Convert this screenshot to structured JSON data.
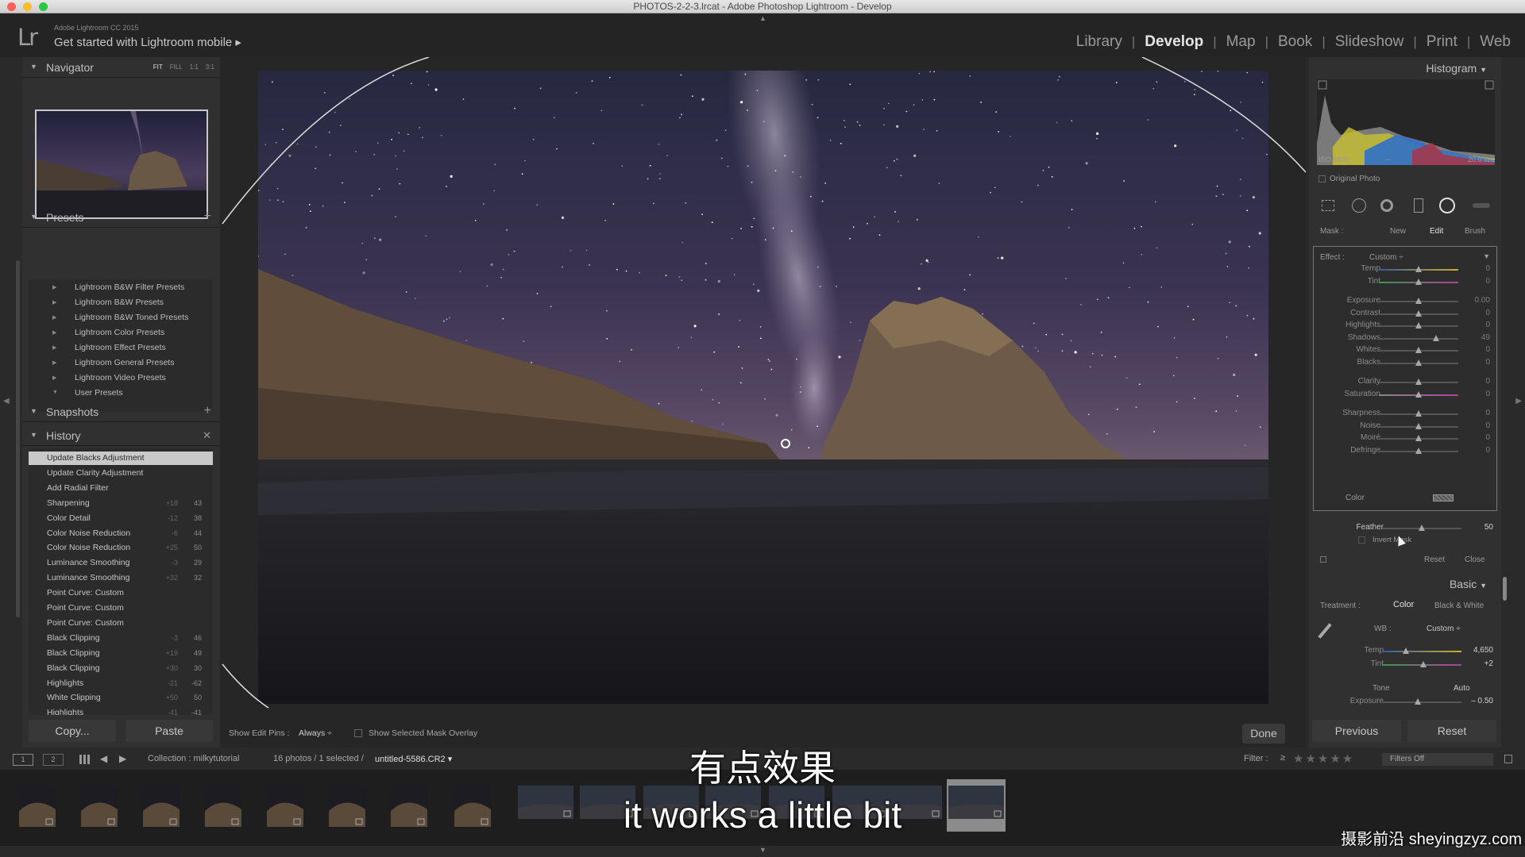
{
  "window": {
    "title": "PHOTOS-2-2-3.lrcat - Adobe Photoshop Lightroom - Develop"
  },
  "identity": {
    "logo": "Lr",
    "brand": "Adobe Lightroom CC 2015",
    "mobile_prompt": "Get started with Lightroom mobile ▸"
  },
  "modules": [
    "Library",
    "Develop",
    "Map",
    "Book",
    "Slideshow",
    "Print",
    "Web"
  ],
  "active_module": "Develop",
  "navigator": {
    "title": "Navigator",
    "zoom": [
      "FIT",
      "FILL",
      "1:1",
      "3:1"
    ]
  },
  "presets": {
    "title": "Presets",
    "items": [
      "Lightroom B&W Filter Presets",
      "Lightroom B&W Presets",
      "Lightroom B&W Toned Presets",
      "Lightroom Color Presets",
      "Lightroom Effect Presets",
      "Lightroom General Presets",
      "Lightroom Video Presets",
      "User Presets"
    ]
  },
  "snapshots": {
    "title": "Snapshots"
  },
  "history": {
    "title": "History",
    "items": [
      {
        "label": "Update Blacks Adjustment",
        "before": "",
        "after": ""
      },
      {
        "label": "Update Clarity Adjustment",
        "before": "",
        "after": ""
      },
      {
        "label": "Add Radial Filter",
        "before": "",
        "after": ""
      },
      {
        "label": "Sharpening",
        "before": "+18",
        "after": "43"
      },
      {
        "label": "Color Detail",
        "before": "-12",
        "after": "38"
      },
      {
        "label": "Color Noise Reduction",
        "before": "-6",
        "after": "44"
      },
      {
        "label": "Color Noise Reduction",
        "before": "+25",
        "after": "50"
      },
      {
        "label": "Luminance Smoothing",
        "before": "-3",
        "after": "29"
      },
      {
        "label": "Luminance Smoothing",
        "before": "+32",
        "after": "32"
      },
      {
        "label": "Point Curve: Custom",
        "before": "",
        "after": ""
      },
      {
        "label": "Point Curve: Custom",
        "before": "",
        "after": ""
      },
      {
        "label": "Point Curve: Custom",
        "before": "",
        "after": ""
      },
      {
        "label": "Black Clipping",
        "before": "-3",
        "after": "46"
      },
      {
        "label": "Black Clipping",
        "before": "+19",
        "after": "49"
      },
      {
        "label": "Black Clipping",
        "before": "+30",
        "after": "30"
      },
      {
        "label": "Highlights",
        "before": "-21",
        "after": "-62"
      },
      {
        "label": "White Clipping",
        "before": "+50",
        "after": "50"
      },
      {
        "label": "Highlights",
        "before": "-41",
        "after": "-41"
      }
    ]
  },
  "left_buttons": {
    "copy": "Copy...",
    "paste": "Paste"
  },
  "toolbar": {
    "show_pins_label": "Show Edit Pins :",
    "show_pins_value": "Always ÷",
    "overlay_label": "Show Selected Mask Overlay",
    "done": "Done"
  },
  "histogram": {
    "title": "Histogram",
    "iso": "ISO 6400",
    "dash": "--",
    "shutter": "20.0 sec",
    "original_photo": "Original Photo"
  },
  "mask": {
    "label": "Mask :",
    "new": "New",
    "edit": "Edit",
    "brush": "Brush"
  },
  "effect": {
    "label": "Effect :",
    "preset": "Custom ÷"
  },
  "sliders": [
    {
      "label": "Temp",
      "value": "0",
      "pos": 0.5
    },
    {
      "label": "Tint",
      "value": "0",
      "pos": 0.5
    },
    {
      "label": "Exposure",
      "value": "0.00",
      "pos": 0.5
    },
    {
      "label": "Contrast",
      "value": "0",
      "pos": 0.5
    },
    {
      "label": "Highlights",
      "value": "0",
      "pos": 0.5
    },
    {
      "label": "Shadows",
      "value": "49",
      "pos": 0.72
    },
    {
      "label": "Whites",
      "value": "0",
      "pos": 0.5
    },
    {
      "label": "Blacks",
      "value": "0",
      "pos": 0.5
    },
    {
      "label": "Clarity",
      "value": "0",
      "pos": 0.5
    },
    {
      "label": "Saturation",
      "value": "0",
      "pos": 0.5
    },
    {
      "label": "Sharpness",
      "value": "0",
      "pos": 0.5
    },
    {
      "label": "Noise",
      "value": "0",
      "pos": 0.5
    },
    {
      "label": "Moiré",
      "value": "0",
      "pos": 0.5
    },
    {
      "label": "Defringe",
      "value": "0",
      "pos": 0.5
    }
  ],
  "color_label": "Color",
  "feather": {
    "label": "Feather",
    "value": "50",
    "pos": 0.5
  },
  "invert_mask": "Invert Mask",
  "mask_actions": {
    "reset": "Reset",
    "close": "Close"
  },
  "basic": {
    "title": "Basic",
    "treatment_label": "Treatment :",
    "color": "Color",
    "bw": "Black & White",
    "wb_label": "WB :",
    "wb_value": "Custom ÷",
    "temp": {
      "label": "Temp",
      "value": "4,650",
      "pos": 0.3
    },
    "tint": {
      "label": "Tint",
      "value": "+2",
      "pos": 0.52
    },
    "tone_label": "Tone",
    "auto": "Auto",
    "exposure": {
      "label": "Exposure",
      "value": "– 0.50",
      "pos": 0.45
    }
  },
  "right_buttons": {
    "previous": "Previous",
    "reset": "Reset"
  },
  "filmstrip": {
    "page1": "1",
    "page2": "2",
    "collection": "Collection : milkytutorial",
    "count": "16 photos / 1 selected /",
    "filename": "untitled-5586.CR2 ▾",
    "filter_label": "Filter :",
    "filter_op": "≥",
    "filters_off": "Filters Off"
  },
  "subtitle": {
    "chinese": "有点效果",
    "english": "it works a little bit"
  },
  "watermark": "摄影前沿 sheyingzyz.com"
}
